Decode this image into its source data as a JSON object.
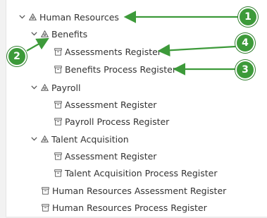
{
  "tree": {
    "items": [
      {
        "label": "Human Resources",
        "expanded": true,
        "icon": "org-unit-icon"
      },
      {
        "label": "Benefits",
        "expanded": true,
        "icon": "org-unit-icon"
      },
      {
        "label": "Assessments Register",
        "icon": "register-icon"
      },
      {
        "label": "Benefits Process Register",
        "icon": "register-icon"
      },
      {
        "label": "Payroll",
        "expanded": true,
        "icon": "org-unit-icon"
      },
      {
        "label": "Assessment Register",
        "icon": "register-icon"
      },
      {
        "label": "Payroll Process Register",
        "icon": "register-icon"
      },
      {
        "label": "Talent Acquisition",
        "expanded": true,
        "icon": "org-unit-icon"
      },
      {
        "label": "Assessment Register",
        "icon": "register-icon"
      },
      {
        "label": "Talent Acquisition Process Register",
        "icon": "register-icon"
      },
      {
        "label": "Human Resources Assessment Register",
        "icon": "register-icon"
      },
      {
        "label": "Human Resources Process Register",
        "icon": "register-icon"
      }
    ]
  },
  "callouts": [
    {
      "number": "1"
    },
    {
      "number": "2"
    },
    {
      "number": "3"
    },
    {
      "number": "4"
    }
  ],
  "colors": {
    "callout": "#3d9a3a",
    "text": "#333333",
    "icon": "#555555"
  }
}
